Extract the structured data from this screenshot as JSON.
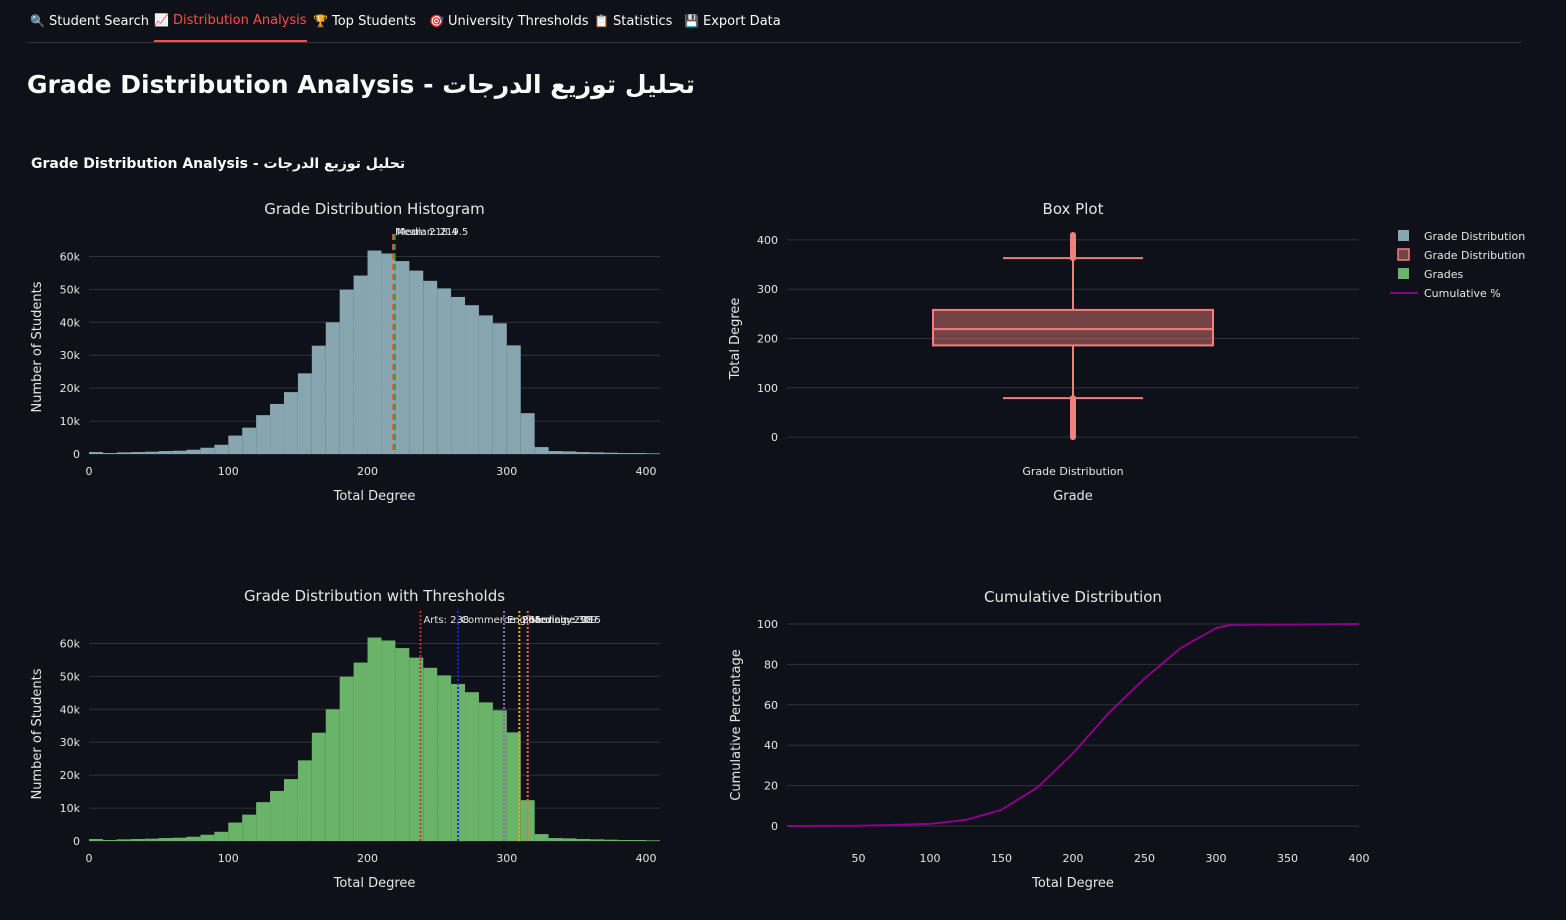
{
  "tabs": [
    {
      "label": "Student Search",
      "icon": "search-icon",
      "glyph": "🔍",
      "active": false
    },
    {
      "label": "Distribution Analysis",
      "icon": "chart-increasing-icon",
      "glyph": "📈",
      "active": true
    },
    {
      "label": "Top Students",
      "icon": "trophy-icon",
      "glyph": "🏆",
      "active": false
    },
    {
      "label": "University Thresholds",
      "icon": "target-icon",
      "glyph": "🎯",
      "active": false
    },
    {
      "label": "Statistics",
      "icon": "clipboard-icon",
      "glyph": "📋",
      "active": false
    },
    {
      "label": "Export Data",
      "icon": "floppy-disk-icon",
      "glyph": "💾",
      "active": false
    }
  ],
  "colors": {
    "background": "#0e1117",
    "active_tab": "#ff4b4b",
    "histogram": "#87a6b0",
    "box": "#f08080",
    "thresholds_hist": "#6ab46a",
    "cumulative": "#8b008b",
    "mean_line": "#ff4b4b",
    "median_line": "#2ca02c"
  },
  "page": {
    "title": "Grade Distribution Analysis - تحليل توزيع الدرجات",
    "figure_title": "Grade Distribution Analysis - تحليل توزيع الدرجات"
  },
  "chart_data": [
    {
      "type": "bar",
      "title": "Grade Distribution Histogram",
      "xlabel": "Total Degree",
      "ylabel": "Number of Students",
      "series_name": "Grade Distribution",
      "bin_starts": [
        0,
        10,
        20,
        30,
        40,
        50,
        60,
        70,
        80,
        90,
        100,
        110,
        120,
        130,
        140,
        150,
        160,
        170,
        180,
        190,
        200,
        210,
        220,
        230,
        240,
        250,
        260,
        270,
        280,
        290,
        300,
        310,
        320,
        330,
        340,
        350,
        360,
        370,
        380,
        390,
        400
      ],
      "bin_width": 10,
      "values": [
        600,
        300,
        500,
        600,
        700,
        900,
        1000,
        1300,
        1900,
        2800,
        5600,
        8000,
        11800,
        15200,
        18800,
        24500,
        32900,
        40000,
        49900,
        54200,
        61800,
        60900,
        58600,
        55700,
        52600,
        50300,
        47700,
        45200,
        42100,
        39700,
        33000,
        12400,
        2100,
        900,
        800,
        600,
        500,
        400,
        300,
        300,
        200
      ],
      "xlim": [
        0,
        410
      ],
      "ylim": [
        0,
        65000
      ],
      "xticks": [
        0,
        100,
        200,
        300,
        400
      ],
      "yticks": [
        0,
        10000,
        20000,
        30000,
        40000,
        50000,
        60000
      ],
      "ytick_labels": [
        "0",
        "10k",
        "20k",
        "30k",
        "40k",
        "50k",
        "60k"
      ],
      "vlines": [
        {
          "label": "Mean: 218.4",
          "x": 218.4,
          "color": "#ff4b4b"
        },
        {
          "label": "Median: 219.5",
          "x": 219.5,
          "color": "#2ca02c"
        }
      ]
    },
    {
      "type": "box",
      "title": "Box Plot",
      "xlabel": "Grade",
      "ylabel": "Total Degree",
      "category": "Grade Distribution",
      "whisker_low": 79,
      "q1": 186,
      "median": 219,
      "q3": 258,
      "whisker_high": 363,
      "outliers_low": [
        0,
        79
      ],
      "outliers_high": [
        363,
        410
      ],
      "ylim": [
        -10,
        410
      ],
      "yticks": [
        0,
        100,
        200,
        300,
        400
      ]
    },
    {
      "type": "bar",
      "title": "Grade Distribution with Thresholds",
      "xlabel": "Total Degree",
      "ylabel": "Number of Students",
      "series_name": "Grades",
      "xlim": [
        0,
        410
      ],
      "ylim": [
        0,
        65000
      ],
      "xticks": [
        0,
        100,
        200,
        300,
        400
      ],
      "yticks": [
        0,
        10000,
        20000,
        30000,
        40000,
        50000,
        60000
      ],
      "ytick_labels": [
        "0",
        "10k",
        "20k",
        "30k",
        "40k",
        "50k",
        "60k"
      ],
      "thresholds": [
        {
          "label": "Arts: 238",
          "x": 238,
          "color": "#d62728"
        },
        {
          "label": "Commerce: 265",
          "x": 265,
          "color": "#1f1fff"
        },
        {
          "label": "Engineering: 298",
          "x": 298,
          "color": "#9467bd"
        },
        {
          "label": "Pharmacy: 309",
          "x": 309,
          "color": "#ffa500"
        },
        {
          "label": "Medicine: 315",
          "x": 315,
          "color": "#ff6347"
        }
      ]
    },
    {
      "type": "line",
      "title": "Cumulative Distribution",
      "xlabel": "Total Degree",
      "ylabel": "Cumulative Percentage",
      "series_name": "Cumulative %",
      "x": [
        0,
        50,
        100,
        125,
        150,
        175,
        200,
        225,
        250,
        275,
        300,
        310,
        400
      ],
      "y": [
        0,
        0.1,
        1,
        3,
        8,
        19,
        36,
        56,
        73,
        88,
        98,
        99.5,
        100
      ],
      "xlim": [
        0,
        400
      ],
      "ylim": [
        -2,
        102
      ],
      "xticks": [
        50,
        100,
        150,
        200,
        250,
        300,
        350,
        400
      ],
      "yticks": [
        0,
        20,
        40,
        60,
        80,
        100
      ]
    }
  ],
  "legend": [
    {
      "label": "Grade Distribution",
      "kind": "square",
      "color": "#87a6b0"
    },
    {
      "label": "Grade Distribution",
      "kind": "box",
      "color": "#f08080"
    },
    {
      "label": "Grades",
      "kind": "square",
      "color": "#6ab46a"
    },
    {
      "label": "Cumulative %",
      "kind": "line",
      "color": "#8b008b"
    }
  ]
}
